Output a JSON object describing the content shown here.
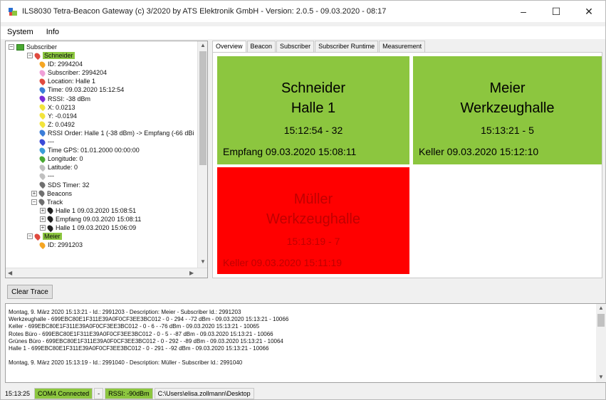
{
  "window": {
    "title": "ILS8030 Tetra-Beacon Gateway (c) 3/2020 by ATS Elektronik GmbH - Version: 2.0.5 - 09.03.2020 - 08:17",
    "minimize": "–",
    "maximize": "☐",
    "close": "✕"
  },
  "menu": [
    "System",
    "Info"
  ],
  "tree": {
    "root": "Subscriber",
    "nodes": [
      {
        "label": "Schneider",
        "selected": true,
        "color": "#e04a3f"
      },
      {
        "label": "ID: 2994204",
        "color": "#f5a623"
      },
      {
        "label": "Subscriber: 2994204",
        "color": "#f0a0d8"
      },
      {
        "label": "Location: Halle 1",
        "color": "#e04a3f"
      },
      {
        "label": "Time: 09.03.2020 15:12:54",
        "color": "#3b7dd8"
      },
      {
        "label": "RSSI: -38 dBm",
        "color": "#7a2ad8"
      },
      {
        "label": "X: 0.0213",
        "color": "#f2e43c"
      },
      {
        "label": "Y: -0.0194",
        "color": "#f2e43c"
      },
      {
        "label": "Z: 0.0492",
        "color": "#f2e43c"
      },
      {
        "label": "RSSI Order: Halle 1 (-38 dBm) -> Empfang (-66 dBi",
        "color": "#3b7dd8"
      },
      {
        "label": "---",
        "color": "#3b4ad8"
      },
      {
        "label": "Time GPS: 01.01.2000 00:00:00",
        "color": "#3b9dd8"
      },
      {
        "label": "Longitude: 0",
        "color": "#4aa832"
      },
      {
        "label": "Latitude: 0",
        "color": "#c0c0c0"
      },
      {
        "label": "---",
        "color": "#c0c0c0"
      },
      {
        "label": "SDS Timer: 32",
        "color": "#707070"
      },
      {
        "label": "Beacons",
        "color": "#707070"
      },
      {
        "label": "Track",
        "color": "#707070"
      },
      {
        "label": "Halle 1  09.03.2020 15:08:51",
        "color": "#222222"
      },
      {
        "label": "Empfang  09.03.2020 15:08:11",
        "color": "#222222"
      },
      {
        "label": "Halle 1  09.03.2020 15:06:09",
        "color": "#222222"
      },
      {
        "label": "Meier",
        "selected": true,
        "color": "#e04a3f"
      },
      {
        "label": "ID: 2991203",
        "color": "#f5a623"
      }
    ]
  },
  "tabs": [
    "Overview",
    "Beacon",
    "Subscriber",
    "Subscriber Runtime",
    "Measurement"
  ],
  "tiles": [
    {
      "name": "Schneider",
      "location": "Halle 1",
      "time": "15:12:54 - 32",
      "last": "Empfang  09.03.2020 15:08:11",
      "bg": "#8cc63f"
    },
    {
      "name": "Meier",
      "location": "Werkzeughalle",
      "time": "15:13:21 - 5",
      "last": "Keller  09.03.2020 15:12:10",
      "bg": "#8cc63f"
    },
    {
      "name": "Müller",
      "location": "Werkzeughalle",
      "time": "15:13:19 - 7",
      "last": "Keller  09.03.2020 15:11:19",
      "bg": "#ff0000"
    }
  ],
  "clear_button": "Clear Trace",
  "log": [
    "Montag, 9. März 2020  15:13:21 - Id.: 2991203 - Description: Meier - Subscriber Id.: 2991203",
    "  Werkzeughalle - 699EBC80E1F311E39A0F0CF3EE3BC012 - 0 - 294 - -72 dBm - 09.03.2020 15:13:21 - 10066",
    "  Keller - 699EBC80E1F311E39A0F0CF3EE3BC012 - 0 - 6 - -76 dBm - 09.03.2020 15:13:21 - 10065",
    "  Rotes Büro - 699EBC80E1F311E39A0F0CF3EE3BC012 - 0 - 5 - -87 dBm - 09.03.2020 15:13:21 - 10066",
    "  Grünes Büro - 699EBC80E1F311E39A0F0CF3EE3BC012 - 0 - 292 - -89 dBm - 09.03.2020 15:13:21 - 10064",
    "  Halle 1 - 699EBC80E1F311E39A0F0CF3EE3BC012 - 0 - 291 - -92 dBm - 09.03.2020 15:13:21 - 10066",
    "",
    "Montag, 9. März 2020  15:13:19 - Id.: 2991040 - Description: Müller - Subscriber Id.: 2991040"
  ],
  "status": {
    "time": "15:13:25",
    "port": "COM4 Connected",
    "dash": "-",
    "rssi": "RSSI: -90dBm",
    "path": "C:\\Users\\elisa.zollmann\\Desktop"
  }
}
